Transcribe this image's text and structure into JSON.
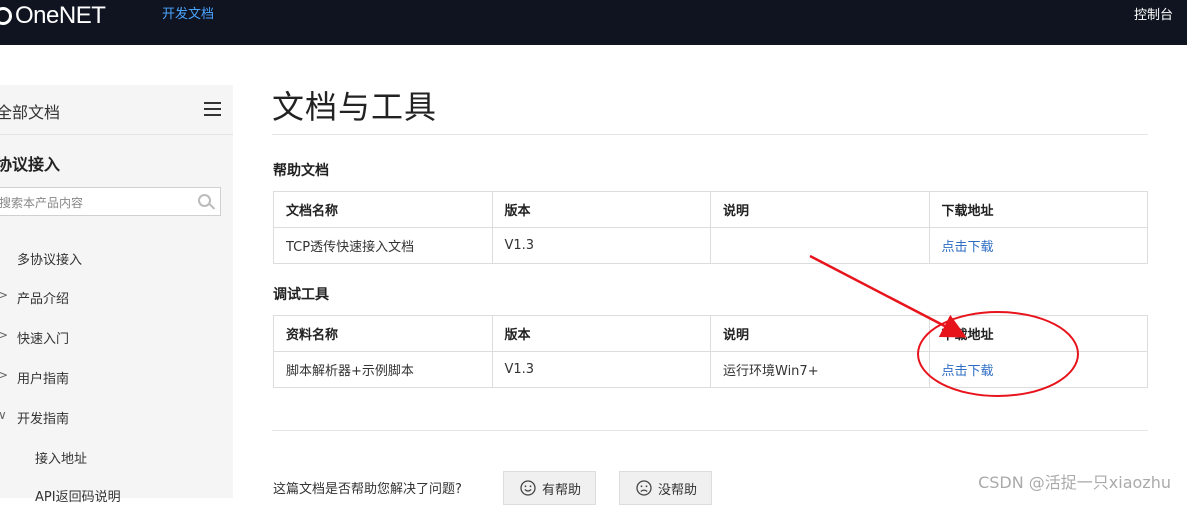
{
  "header": {
    "logo_text": "OneNET",
    "nav_docs": "开发文档",
    "nav_console": "控制台"
  },
  "sidebar": {
    "title": "全部文档",
    "section": "协议接入",
    "search_placeholder": "搜索本产品内容",
    "items": [
      {
        "label": "多协议接入",
        "expander": ""
      },
      {
        "label": "产品介绍",
        "expander": ">"
      },
      {
        "label": "快速入门",
        "expander": ">"
      },
      {
        "label": "用户指南",
        "expander": ">"
      },
      {
        "label": "开发指南",
        "expander": "∨"
      },
      {
        "label": "接入地址",
        "expander": ""
      },
      {
        "label": "API返回码说明",
        "expander": ""
      }
    ]
  },
  "main": {
    "title": "文档与工具",
    "help_docs": {
      "heading": "帮助文档",
      "columns": [
        "文档名称",
        "版本",
        "说明",
        "下载地址"
      ],
      "rows": [
        {
          "name": "TCP透传快速接入文档",
          "version": "V1.3",
          "desc": "",
          "download": "点击下载"
        }
      ]
    },
    "debug_tools": {
      "heading": "调试工具",
      "columns": [
        "资料名称",
        "版本",
        "说明",
        "下载地址"
      ],
      "rows": [
        {
          "name": "脚本解析器+示例脚本",
          "version": "V1.3",
          "desc": "运行环境Win7+",
          "download": "点击下载"
        }
      ]
    },
    "feedback": {
      "question": "这篇文档是否帮助您解决了问题?",
      "helpful": "有帮助",
      "not_helpful": "没帮助"
    }
  },
  "watermark": "CSDN @活捉一只xiaozhu",
  "colors": {
    "topbar": "#0f1420",
    "nav_link": "#4aa3ff",
    "link": "#2d6dc4",
    "annotation": "#e8141c"
  }
}
